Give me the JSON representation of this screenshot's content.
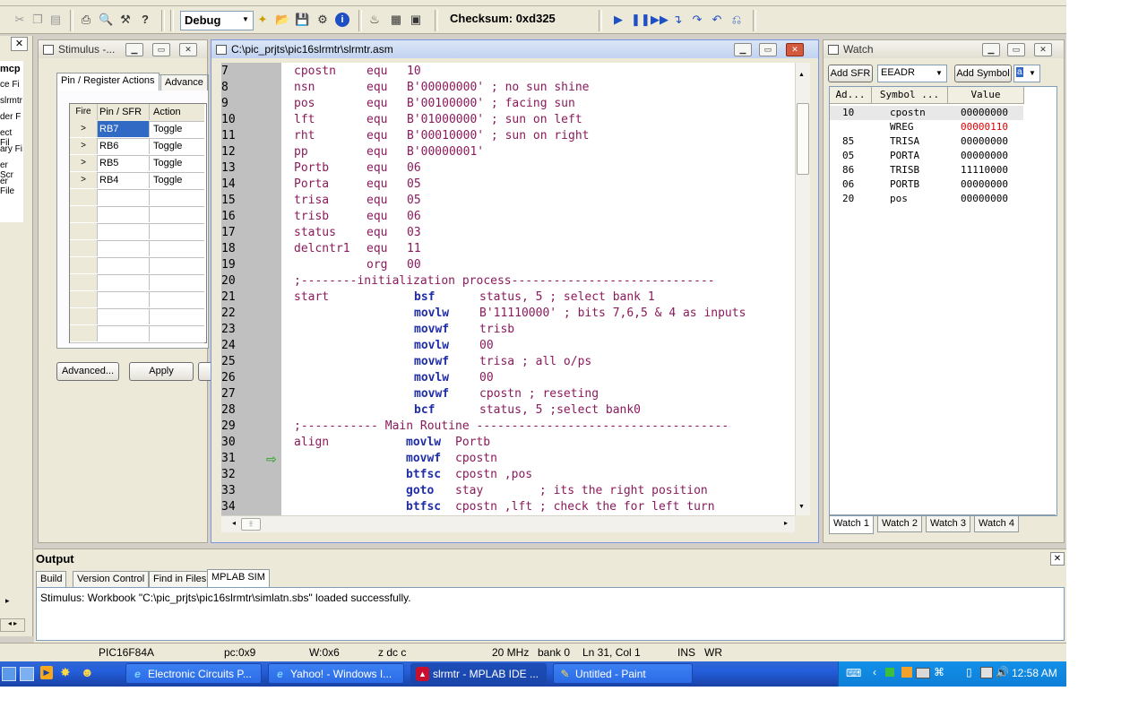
{
  "toolbar": {
    "config_value": "Debug",
    "checksum_label": "Checksum: 0xd325"
  },
  "workspace": {
    "items": [
      "mcp",
      "ce Fi",
      "slrmtr",
      "der F",
      "ect Fil",
      "ary Fi",
      "er Scr",
      "er File"
    ]
  },
  "stimulus": {
    "title": "Stimulus -...",
    "tabs": [
      "Pin / Register Actions",
      "Advance"
    ],
    "columns": [
      "Fire",
      "Pin / SFR",
      "Action"
    ],
    "rows": [
      {
        "fire": ">",
        "pin": "RB7",
        "action": "Toggle"
      },
      {
        "fire": ">",
        "pin": "RB6",
        "action": "Toggle"
      },
      {
        "fire": ">",
        "pin": "RB5",
        "action": "Toggle"
      },
      {
        "fire": ">",
        "pin": "RB4",
        "action": "Toggle"
      }
    ],
    "advanced_button": "Advanced...",
    "apply_button": "Apply"
  },
  "editor": {
    "title": "C:\\pic_prjts\\pic16slrmtr\\slrmtr.asm",
    "current_line": "31",
    "lines": [
      {
        "n": "7",
        "label": "cpostn",
        "op": "equ",
        "args": "10"
      },
      {
        "n": "8",
        "label": "nsn",
        "op": "equ",
        "args": "B'00000000' ; no sun shine"
      },
      {
        "n": "9",
        "label": "pos",
        "op": "equ",
        "args": "B'00100000' ; facing sun"
      },
      {
        "n": "10",
        "label": "lft",
        "op": "equ",
        "args": "B'01000000' ; sun on left"
      },
      {
        "n": "11",
        "label": "rht",
        "op": "equ",
        "args": "B'00010000' ; sun on right"
      },
      {
        "n": "12",
        "label": "pp",
        "op": "equ",
        "args": "B'00000001'"
      },
      {
        "n": "13",
        "label": "Portb",
        "op": "equ",
        "args": "06"
      },
      {
        "n": "14",
        "label": "Porta",
        "op": "equ",
        "args": "05"
      },
      {
        "n": "15",
        "label": "trisa",
        "op": "equ",
        "args": "05"
      },
      {
        "n": "16",
        "label": "trisb",
        "op": "equ",
        "args": "06"
      },
      {
        "n": "17",
        "label": "status",
        "op": "equ",
        "args": "03"
      },
      {
        "n": "18",
        "label": "delcntr1",
        "op": "equ",
        "args": "11"
      },
      {
        "n": "19",
        "label": "",
        "op": "org",
        "args": "00"
      },
      {
        "n": "20",
        "label": ";--------initialization process-----------------------------",
        "op": "",
        "args": ""
      },
      {
        "n": "21",
        "label": "start",
        "kw": "bsf",
        "args": "status, 5 ; select bank 1"
      },
      {
        "n": "22",
        "label": "",
        "kw": "movlw",
        "args": "B'11110000' ; bits 7,6,5 & 4 as inputs"
      },
      {
        "n": "23",
        "label": "",
        "kw": "movwf",
        "args": "trisb"
      },
      {
        "n": "24",
        "label": "",
        "kw": "movlw",
        "args": "00"
      },
      {
        "n": "25",
        "label": "",
        "kw": "movwf",
        "args": "trisa ; all o/ps"
      },
      {
        "n": "26",
        "label": "",
        "kw": "movlw",
        "args": "00"
      },
      {
        "n": "27",
        "label": "",
        "kw": "movwf",
        "args": "cpostn ; reseting"
      },
      {
        "n": "28",
        "label": "",
        "kw": "bcf",
        "args": "status, 5 ;select bank0"
      },
      {
        "n": "29",
        "label": ";----------- Main Routine ------------------------------------",
        "op": "",
        "args": ""
      },
      {
        "n": "30",
        "label": "align",
        "kw2": "movlw",
        "args2": "Portb"
      },
      {
        "n": "31",
        "label": "",
        "kw2": "movwf",
        "args2": "cpostn"
      },
      {
        "n": "32",
        "label": "",
        "kw2": "btfsc",
        "args2": "cpostn ,pos"
      },
      {
        "n": "33",
        "label": "",
        "kw2": "goto",
        "args2": "stay        ; its the right position"
      },
      {
        "n": "34",
        "label": "",
        "kw2": "btfsc",
        "args2": "cpostn ,lft ; check the for left turn"
      }
    ]
  },
  "watch": {
    "title": "Watch",
    "add_sfr": "Add SFR",
    "sfr_value": "EEADR",
    "add_symbol": "Add Symbol",
    "symbol_value": "a",
    "columns": [
      "Ad...",
      "Symbol ...",
      "Value"
    ],
    "rows": [
      {
        "addr": "10",
        "symbol": "cpostn",
        "value": "00000000",
        "changed": false
      },
      {
        "addr": "",
        "symbol": "WREG",
        "value": "00000110",
        "changed": true
      },
      {
        "addr": "85",
        "symbol": "TRISA",
        "value": "00000000",
        "changed": false
      },
      {
        "addr": "05",
        "symbol": "PORTA",
        "value": "00000000",
        "changed": false
      },
      {
        "addr": "86",
        "symbol": "TRISB",
        "value": "11110000",
        "changed": false
      },
      {
        "addr": "06",
        "symbol": "PORTB",
        "value": "00000000",
        "changed": false
      },
      {
        "addr": "20",
        "symbol": "pos",
        "value": "00000000",
        "changed": false
      }
    ],
    "tabs": [
      "Watch 1",
      "Watch 2",
      "Watch 3",
      "Watch 4"
    ]
  },
  "output": {
    "title": "Output",
    "tabs": [
      "Build",
      "Version Control",
      "Find in Files",
      "MPLAB SIM"
    ],
    "message": "Stimulus: Workbook \"C:\\pic_prjts\\pic16slrmtr\\simlatn.sbs\" loaded successfully."
  },
  "statusbar": {
    "device": "PIC16F84A",
    "pc": "pc:0x9",
    "w": "W:0x6",
    "flags": "z dc c",
    "freq": "20 MHz",
    "bank": "bank 0",
    "position": "Ln 31, Col 1",
    "ins": "INS",
    "wr": "WR"
  },
  "taskbar": {
    "tasks": [
      "Electronic Circuits P...",
      "Yahoo! - Windows I...",
      "slrmtr - MPLAB IDE ...",
      "Untitled - Paint"
    ],
    "clock": "12:58 AM"
  },
  "colors": {
    "keyword": "#1f2ea8",
    "operand": "#8b1a5c",
    "changed_value": "#e00000",
    "selection": "#316ac5"
  }
}
